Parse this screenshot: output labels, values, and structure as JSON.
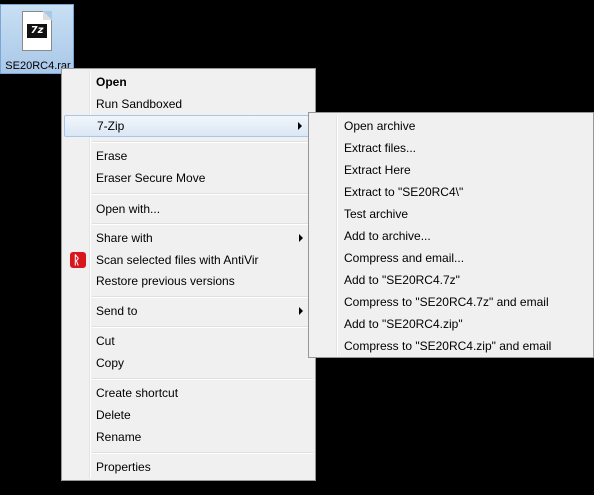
{
  "desktop": {
    "file_name": "SE20RC4.rar",
    "file_badge": "7z"
  },
  "context_menu": {
    "items": [
      {
        "label": "Open"
      },
      {
        "label": "Run Sandboxed"
      },
      {
        "label": "7-Zip"
      },
      {
        "label": "Erase"
      },
      {
        "label": "Eraser Secure Move"
      },
      {
        "label": "Open with..."
      },
      {
        "label": "Share with"
      },
      {
        "label": "Scan selected files with AntiVir"
      },
      {
        "label": "Restore previous versions"
      },
      {
        "label": "Send to"
      },
      {
        "label": "Cut"
      },
      {
        "label": "Copy"
      },
      {
        "label": "Create shortcut"
      },
      {
        "label": "Delete"
      },
      {
        "label": "Rename"
      },
      {
        "label": "Properties"
      }
    ]
  },
  "submenu_7zip": {
    "items": [
      {
        "label": "Open archive"
      },
      {
        "label": "Extract files..."
      },
      {
        "label": "Extract Here"
      },
      {
        "label": "Extract to \"SE20RC4\\\""
      },
      {
        "label": "Test archive"
      },
      {
        "label": "Add to archive..."
      },
      {
        "label": "Compress and email..."
      },
      {
        "label": "Add to \"SE20RC4.7z\""
      },
      {
        "label": "Compress to \"SE20RC4.7z\" and email"
      },
      {
        "label": "Add to \"SE20RC4.zip\""
      },
      {
        "label": "Compress to \"SE20RC4.zip\" and email"
      }
    ]
  },
  "colors": {
    "desktop_background": "#000000",
    "menu_background": "#f0f0f0",
    "highlight_border": "#a8c6ec",
    "antivir_red": "#d8161b"
  },
  "icons": {
    "file": "7z-archive-icon",
    "antivir": "antivir-umbrella-icon",
    "submenu_arrow": "chevron-right-icon"
  }
}
